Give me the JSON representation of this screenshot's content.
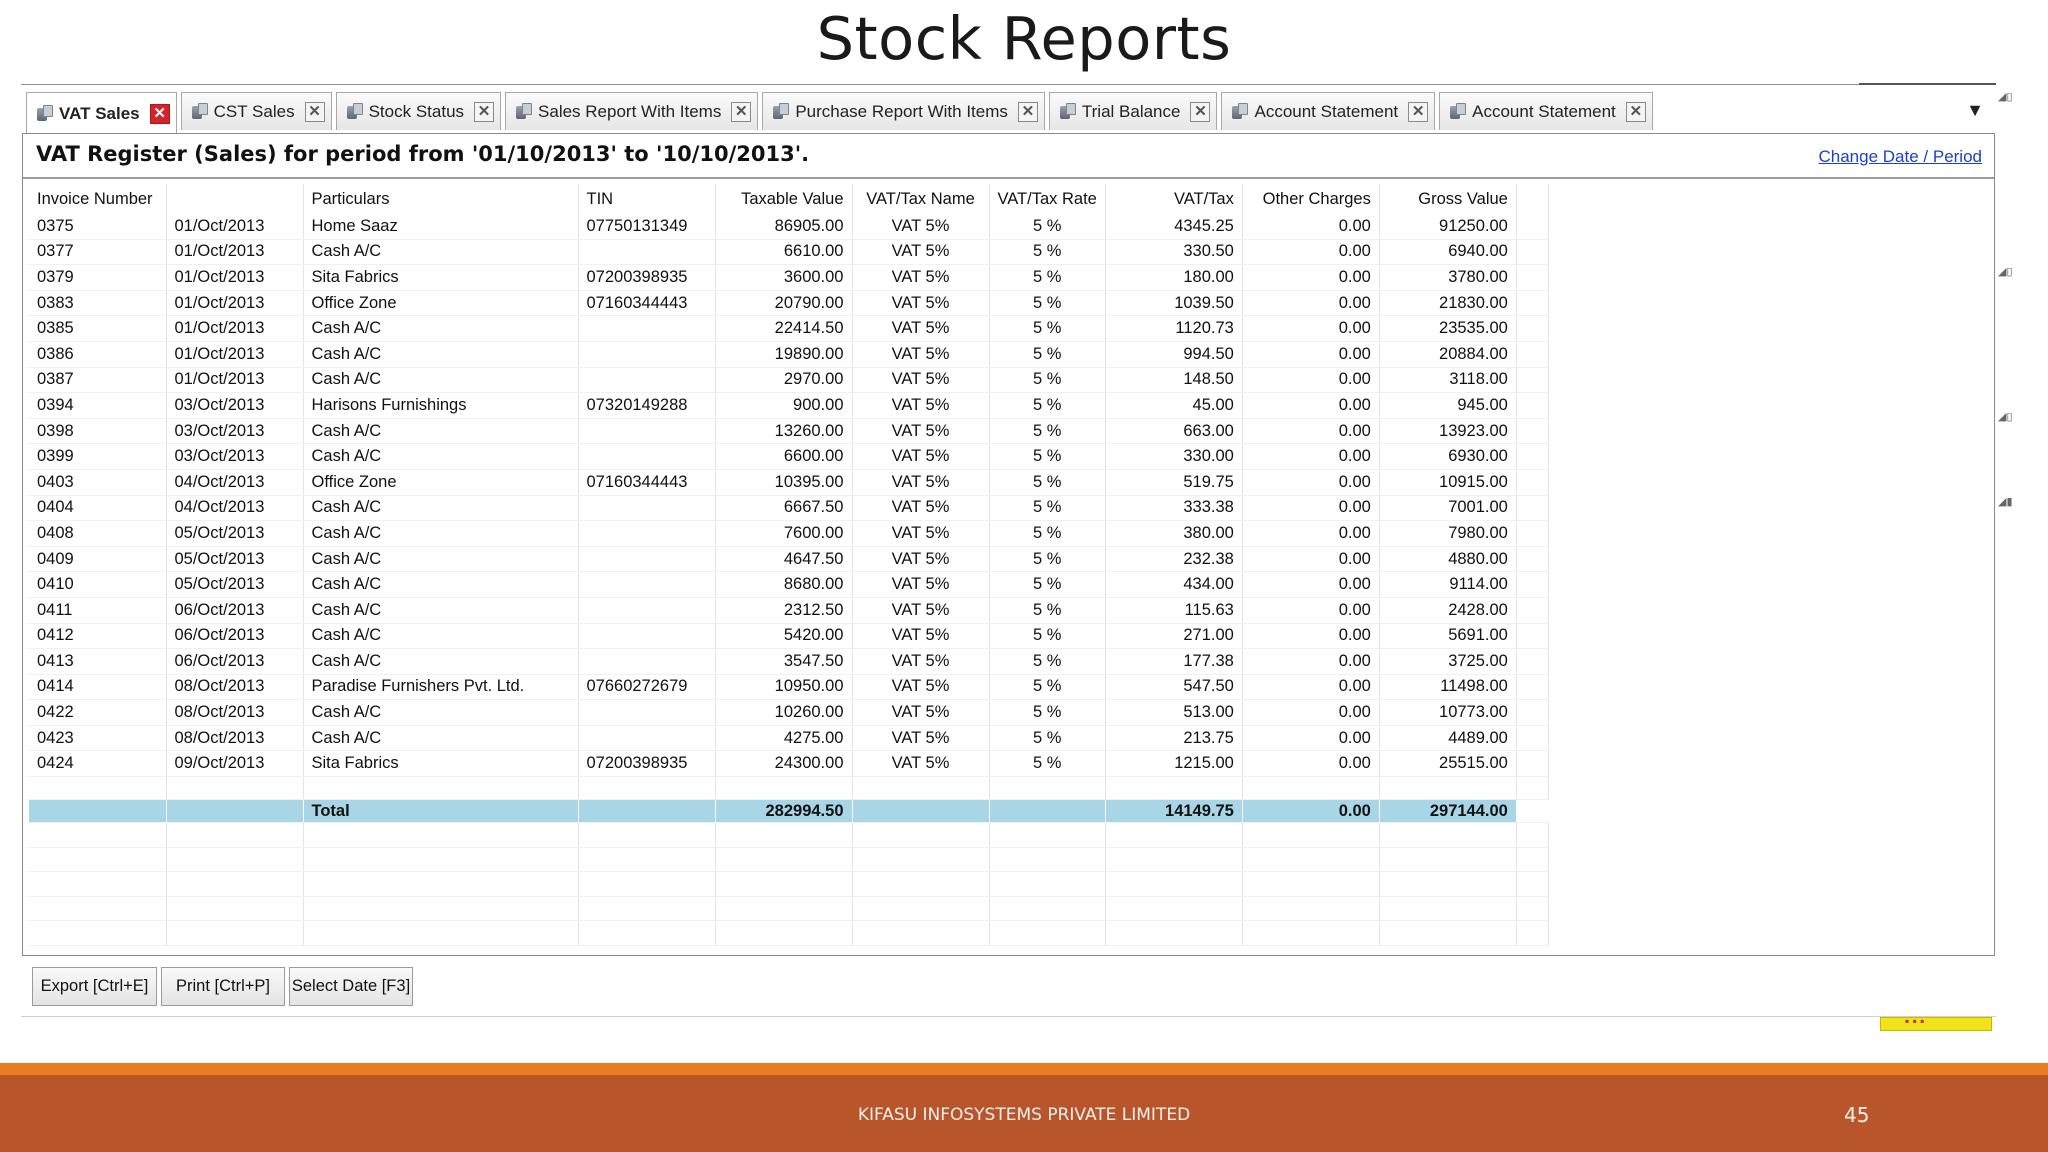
{
  "slide": {
    "title": "Stock Reports",
    "footer_text": "KIFASU INFOSYSTEMS PRIVATE LIMITED",
    "page_number": "45"
  },
  "tabs": [
    {
      "label": "VAT Sales",
      "active": true
    },
    {
      "label": "CST Sales",
      "active": false
    },
    {
      "label": "Stock Status",
      "active": false
    },
    {
      "label": "Sales Report With Items",
      "active": false
    },
    {
      "label": "Purchase Report With Items",
      "active": false
    },
    {
      "label": "Trial Balance",
      "active": false
    },
    {
      "label": "Account Statement",
      "active": false
    },
    {
      "label": "Account Statement",
      "active": false
    }
  ],
  "report": {
    "title": "VAT Register (Sales) for period from '01/10/2013' to '10/10/2013'.",
    "change_link": "Change Date / Period"
  },
  "columns": [
    "Invoice Number",
    "",
    "Particulars",
    "TIN",
    "Taxable Value",
    "VAT/Tax Name",
    "VAT/Tax Rate",
    "VAT/Tax",
    "Other Charges",
    "Gross Value"
  ],
  "rows": [
    [
      "0375",
      "01/Oct/2013",
      "Home Saaz",
      "07750131349",
      "86905.00",
      "VAT 5%",
      "5 %",
      "4345.25",
      "0.00",
      "91250.00"
    ],
    [
      "0377",
      "01/Oct/2013",
      "Cash A/C",
      "",
      "6610.00",
      "VAT 5%",
      "5 %",
      "330.50",
      "0.00",
      "6940.00"
    ],
    [
      "0379",
      "01/Oct/2013",
      "Sita Fabrics",
      "07200398935",
      "3600.00",
      "VAT 5%",
      "5 %",
      "180.00",
      "0.00",
      "3780.00"
    ],
    [
      "0383",
      "01/Oct/2013",
      "Office Zone",
      "07160344443",
      "20790.00",
      "VAT 5%",
      "5 %",
      "1039.50",
      "0.00",
      "21830.00"
    ],
    [
      "0385",
      "01/Oct/2013",
      "Cash A/C",
      "",
      "22414.50",
      "VAT 5%",
      "5 %",
      "1120.73",
      "0.00",
      "23535.00"
    ],
    [
      "0386",
      "01/Oct/2013",
      "Cash A/C",
      "",
      "19890.00",
      "VAT 5%",
      "5 %",
      "994.50",
      "0.00",
      "20884.00"
    ],
    [
      "0387",
      "01/Oct/2013",
      "Cash A/C",
      "",
      "2970.00",
      "VAT 5%",
      "5 %",
      "148.50",
      "0.00",
      "3118.00"
    ],
    [
      "0394",
      "03/Oct/2013",
      "Harisons Furnishings",
      "07320149288",
      "900.00",
      "VAT 5%",
      "5 %",
      "45.00",
      "0.00",
      "945.00"
    ],
    [
      "0398",
      "03/Oct/2013",
      "Cash A/C",
      "",
      "13260.00",
      "VAT 5%",
      "5 %",
      "663.00",
      "0.00",
      "13923.00"
    ],
    [
      "0399",
      "03/Oct/2013",
      "Cash A/C",
      "",
      "6600.00",
      "VAT 5%",
      "5 %",
      "330.00",
      "0.00",
      "6930.00"
    ],
    [
      "0403",
      "04/Oct/2013",
      "Office Zone",
      "07160344443",
      "10395.00",
      "VAT 5%",
      "5 %",
      "519.75",
      "0.00",
      "10915.00"
    ],
    [
      "0404",
      "04/Oct/2013",
      "Cash A/C",
      "",
      "6667.50",
      "VAT 5%",
      "5 %",
      "333.38",
      "0.00",
      "7001.00"
    ],
    [
      "0408",
      "05/Oct/2013",
      "Cash A/C",
      "",
      "7600.00",
      "VAT 5%",
      "5 %",
      "380.00",
      "0.00",
      "7980.00"
    ],
    [
      "0409",
      "05/Oct/2013",
      "Cash A/C",
      "",
      "4647.50",
      "VAT 5%",
      "5 %",
      "232.38",
      "0.00",
      "4880.00"
    ],
    [
      "0410",
      "05/Oct/2013",
      "Cash A/C",
      "",
      "8680.00",
      "VAT 5%",
      "5 %",
      "434.00",
      "0.00",
      "9114.00"
    ],
    [
      "0411",
      "06/Oct/2013",
      "Cash A/C",
      "",
      "2312.50",
      "VAT 5%",
      "5 %",
      "115.63",
      "0.00",
      "2428.00"
    ],
    [
      "0412",
      "06/Oct/2013",
      "Cash A/C",
      "",
      "5420.00",
      "VAT 5%",
      "5 %",
      "271.00",
      "0.00",
      "5691.00"
    ],
    [
      "0413",
      "06/Oct/2013",
      "Cash A/C",
      "",
      "3547.50",
      "VAT 5%",
      "5 %",
      "177.38",
      "0.00",
      "3725.00"
    ],
    [
      "0414",
      "08/Oct/2013",
      "Paradise Furnishers Pvt. Ltd.",
      "07660272679",
      "10950.00",
      "VAT 5%",
      "5 %",
      "547.50",
      "0.00",
      "11498.00"
    ],
    [
      "0422",
      "08/Oct/2013",
      "Cash A/C",
      "",
      "10260.00",
      "VAT 5%",
      "5 %",
      "513.00",
      "0.00",
      "10773.00"
    ],
    [
      "0423",
      "08/Oct/2013",
      "Cash A/C",
      "",
      "4275.00",
      "VAT 5%",
      "5 %",
      "213.75",
      "0.00",
      "4489.00"
    ],
    [
      "0424",
      "09/Oct/2013",
      "Sita Fabrics",
      "07200398935",
      "24300.00",
      "VAT 5%",
      "5 %",
      "1215.00",
      "0.00",
      "25515.00"
    ]
  ],
  "total": {
    "label": "Total",
    "taxable_value": "282994.50",
    "vat_tax": "14149.75",
    "other_charges": "0.00",
    "gross_value": "297144.00"
  },
  "buttons": {
    "export": "Export [Ctrl+E]",
    "print": "Print [Ctrl+P]",
    "select_date": "Select Date [F3]"
  },
  "colors": {
    "active_close": "#d8222a",
    "total_row": "#a8d6e6",
    "link": "#1a3fcf",
    "footer_bar": "#b9552b",
    "footer_accent": "#e87d23"
  }
}
